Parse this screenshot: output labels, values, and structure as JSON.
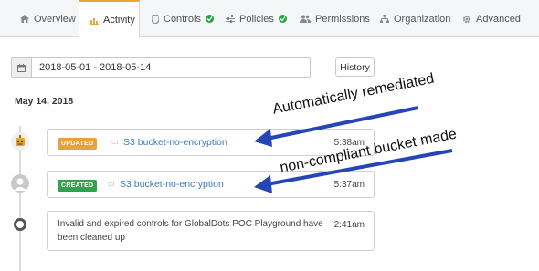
{
  "tabs": [
    {
      "label": "Overview",
      "icon": "home-icon",
      "active": false,
      "check": false
    },
    {
      "label": "Activity",
      "icon": "chart-icon",
      "active": true,
      "check": false
    },
    {
      "label": "Controls",
      "icon": "shield-icon",
      "active": false,
      "check": true
    },
    {
      "label": "Policies",
      "icon": "sliders-icon",
      "active": false,
      "check": true
    },
    {
      "label": "Permissions",
      "icon": "users-icon",
      "active": false,
      "check": false
    },
    {
      "label": "Organization",
      "icon": "org-icon",
      "active": false,
      "check": false
    },
    {
      "label": "Advanced",
      "icon": "gear-icon",
      "active": false,
      "check": false
    }
  ],
  "date_range": {
    "value": "2018-05-01 - 2018-05-14",
    "icon": "calendar-icon"
  },
  "history_button": "History",
  "day_label": "May 14, 2018",
  "events": [
    {
      "badge": "UPDATED",
      "badge_color": "#e9a23b",
      "resource": "S3 bucket-no-encryption",
      "time": "5:38am",
      "avatar": "bot-avatar"
    },
    {
      "badge": "CREATED",
      "badge_color": "#2fa34f",
      "resource": "S3 bucket-no-encryption",
      "time": "5:37am",
      "avatar": "user-avatar"
    },
    {
      "message": "Invalid and expired controls for GlobalDots POC Playground have been cleaned up",
      "time": "2:41am",
      "avatar": "system-ring"
    }
  ],
  "annotations": [
    {
      "text": "Automatically remediated"
    },
    {
      "text": "non-compliant bucket made"
    }
  ],
  "colors": {
    "accent_tab": "#f0a330",
    "link": "#3b7bbf",
    "arrow": "#2646b8",
    "check": "#27a243"
  }
}
